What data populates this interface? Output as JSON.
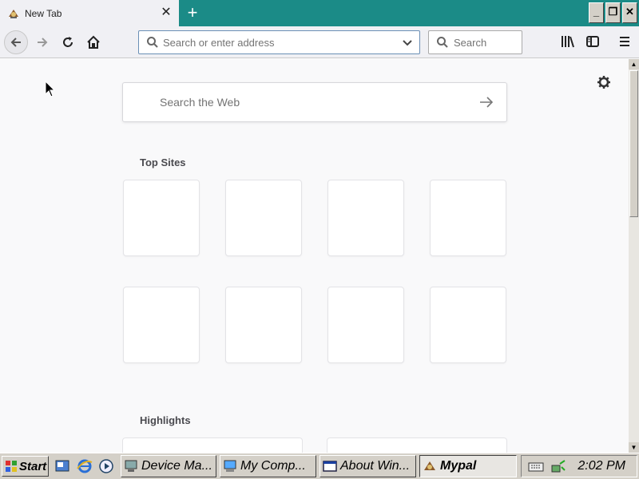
{
  "browser": {
    "tab": {
      "title": "New Tab",
      "close": "✕"
    },
    "new_tab": "+",
    "window_buttons": {
      "minimize": "_",
      "restore": "❐",
      "close": "✕"
    },
    "urlbar": {
      "placeholder": "Search or enter address",
      "value": ""
    },
    "searchbar": {
      "placeholder": "Search",
      "value": ""
    }
  },
  "newtab_page": {
    "web_search": {
      "placeholder": "Search the Web"
    },
    "top_sites_title": "Top Sites",
    "highlights_title": "Highlights",
    "top_sites_count": 8
  },
  "taskbar": {
    "start_label": "Start",
    "tasks": [
      {
        "label": "Device Ma...",
        "icon": "device-manager-icon",
        "active": false
      },
      {
        "label": "My Comp...",
        "icon": "my-computer-icon",
        "active": false
      },
      {
        "label": "About Win...",
        "icon": "about-window-icon",
        "active": false
      },
      {
        "label": "Mypal",
        "icon": "mypal-icon",
        "active": true
      }
    ],
    "clock": "2:02 PM"
  },
  "colors": {
    "titlebar": "#1b8b87",
    "taskbar": "#d4d0c8",
    "page_bg": "#f9f9fa"
  }
}
